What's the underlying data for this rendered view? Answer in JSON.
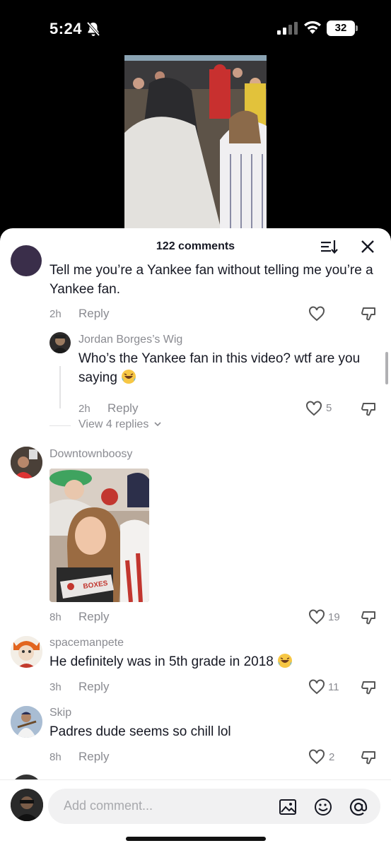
{
  "status": {
    "time": "5:24",
    "battery": "32"
  },
  "sheet": {
    "title": "122 comments"
  },
  "comments": [
    {
      "text": "Tell me you’re a Yankee fan without telling me you’re a Yankee fan.",
      "time": "2h",
      "reply": "Reply"
    },
    {
      "name": "Jordan Borges’s Wig",
      "text": "Who’s the Yankee fan in this video? wtf are you saying",
      "time": "2h",
      "reply": "Reply",
      "likes": "5"
    },
    {
      "view_replies": "View 4 replies"
    },
    {
      "name": "Downtownboosy",
      "time": "8h",
      "reply": "Reply",
      "likes": "19",
      "image_caption": "BOXES"
    },
    {
      "name": "spacemanpete",
      "text": "He definitely was in 5th grade in 2018",
      "time": "3h",
      "reply": "Reply",
      "likes": "11"
    },
    {
      "name": "Skip",
      "text": "Padres dude seems so chill lol",
      "time": "8h",
      "reply": "Reply",
      "likes": "2"
    }
  ],
  "input": {
    "placeholder": "Add comment..."
  },
  "icons": {
    "bell": "bell-slash-icon",
    "sort": "sort-icon",
    "close": "close-icon",
    "like": "heart-icon",
    "dislike": "thumbs-down-icon",
    "image": "image-icon",
    "emoji": "emoji-icon",
    "mention": "at-icon"
  },
  "colors": {
    "text": "#161823",
    "muted": "#8a8b91",
    "background": "#ffffff"
  }
}
